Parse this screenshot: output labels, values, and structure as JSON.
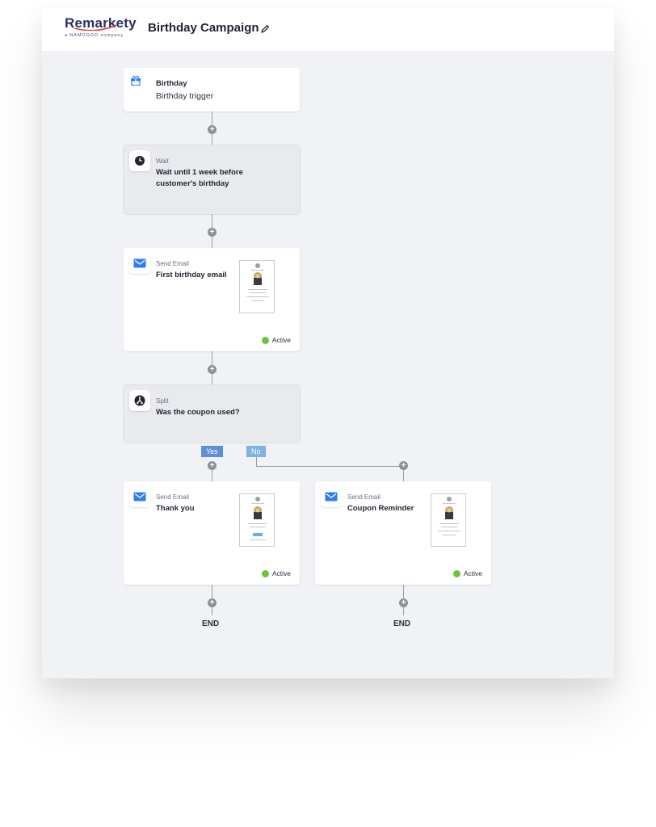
{
  "header": {
    "logo_text": "Remarkety",
    "logo_sub": "a NAMOGOO company",
    "campaign_title": "Birthday Campaign"
  },
  "nodes": {
    "trigger": {
      "type": "Birthday",
      "label": "Birthday trigger"
    },
    "wait": {
      "type": "Wait",
      "label_line1": "Wait until 1 week before",
      "label_line2": "customer's birthday"
    },
    "email1": {
      "type": "Send Email",
      "label": "First birthday email",
      "status": "Active"
    },
    "split": {
      "type": "Split",
      "label": "Was the coupon used?"
    },
    "email_yes": {
      "type": "Send Email",
      "label": "Thank you",
      "status": "Active"
    },
    "email_no": {
      "type": "Send Email",
      "label": "Coupon Reminder",
      "status": "Active"
    }
  },
  "branches": {
    "yes": "Yes",
    "no": "No"
  },
  "add_step_symbol": "+",
  "end_label": "END",
  "colors": {
    "active": "#6cc43c",
    "email_icon": "#2f7cf6",
    "yes_tag": "#5b8fd8",
    "no_tag": "#7fb1e4",
    "canvas": "#f1f2f6"
  },
  "icons": [
    "gift-icon",
    "clock-icon",
    "email-icon",
    "split-icon",
    "edit-icon",
    "plus-icon"
  ]
}
